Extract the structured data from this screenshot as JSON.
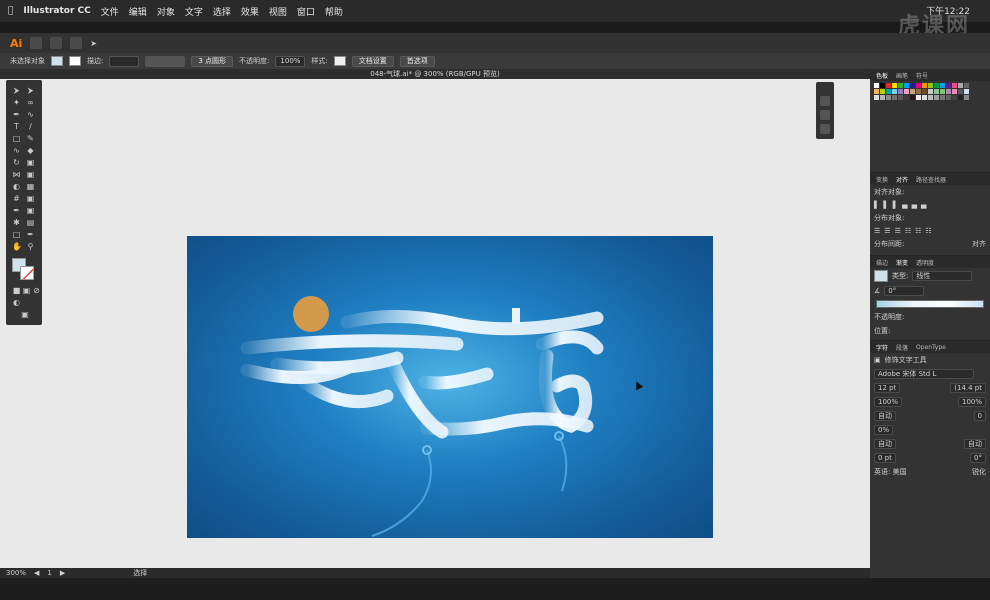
{
  "menubar": {
    "app_name": "Illustrator CC",
    "items": [
      "文件",
      "编辑",
      "对象",
      "文字",
      "选择",
      "效果",
      "视图",
      "窗口",
      "帮助"
    ],
    "clock": "下午12:22"
  },
  "watermark": "虎课网",
  "controlbar": {
    "selection_label": "未选择对象",
    "stroke_label": "描边:",
    "point_style": "3 点圆形",
    "opacity_label": "不透明度:",
    "opacity_value": "100%",
    "style_label": "样式:",
    "doc_setup_button": "文档设置",
    "preferences_button": "首选项"
  },
  "document": {
    "tab_title": "048-气球.ai* @ 300% (RGB/GPU 预览)"
  },
  "status": {
    "zoom": "300%",
    "page": "1",
    "tool_status": "选择"
  },
  "panels": {
    "swatches_tabs": [
      "色板",
      "画笔",
      "符号"
    ],
    "align_tabs": [
      "变换",
      "对齐",
      "路径查找器"
    ],
    "align_objects_label": "对齐对象:",
    "distribute_objects_label": "分布对象:",
    "distribute_spacing_label": "分布间距:",
    "align_to_label": "对齐",
    "gradient_tabs": [
      "描边",
      "渐变",
      "透明度"
    ],
    "gradient_type_label": "类型:",
    "gradient_type_value": "线性",
    "gradient_angle": "0°",
    "opacity_label": "不透明度:",
    "location_label": "位置:",
    "char_tabs": [
      "字符",
      "段落",
      "OpenType"
    ],
    "touch_type_tool": "修饰文字工具",
    "font_name": "Adobe 宋体 Std L",
    "font_size": "12 pt",
    "leading": "(14.4 pt",
    "h_scale": "100%",
    "v_scale": "100%",
    "kerning": "自动",
    "tracking": "0",
    "tsume": "0%",
    "aki_left": "自动",
    "aki_right": "自动",
    "baseline": "0 pt",
    "rotation": "0°",
    "language": "英语: 美国",
    "aa": "锐化"
  },
  "colors": {
    "artboard_bg": "#1a6fb0",
    "accent": "#ff7c00"
  }
}
